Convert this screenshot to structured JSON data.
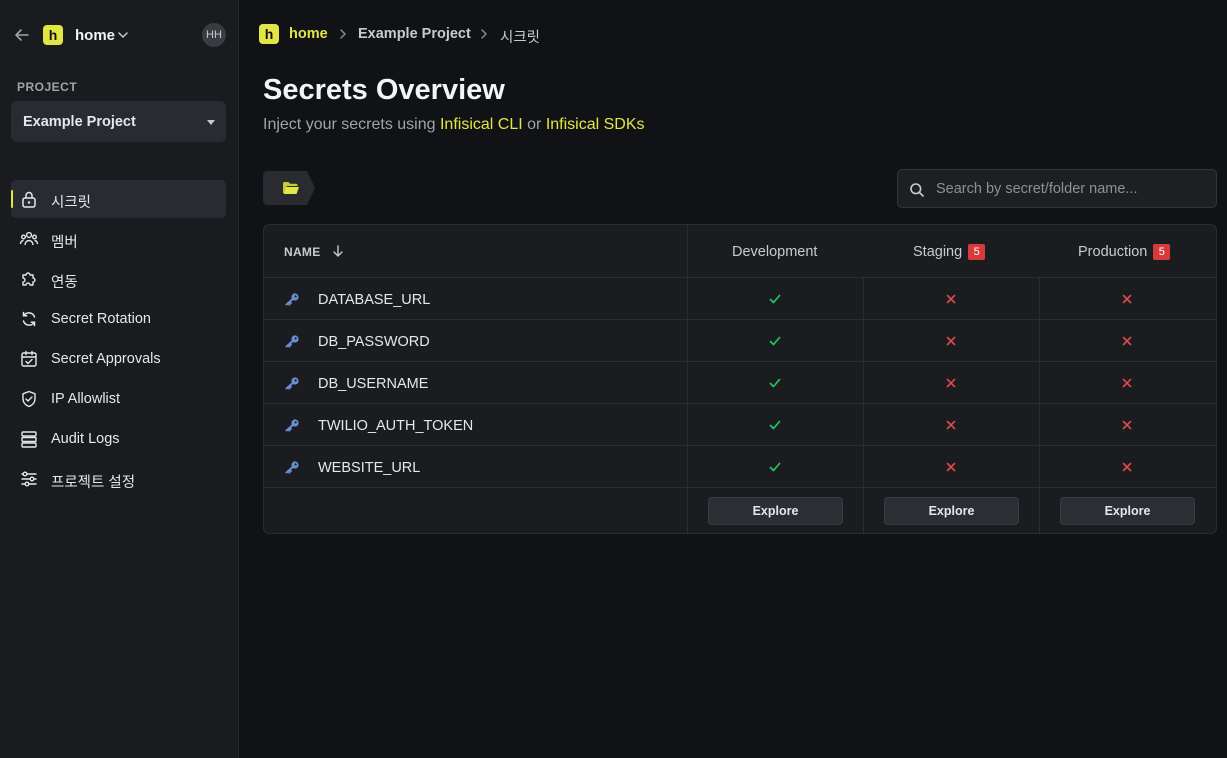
{
  "org": {
    "logo_letter": "h",
    "name": "home",
    "avatar_initials": "HH"
  },
  "project": {
    "section_label": "PROJECT",
    "selected": "Example Project"
  },
  "nav": {
    "items": [
      {
        "label": "시크릿",
        "icon": "lock-icon",
        "active": true
      },
      {
        "label": "멤버",
        "icon": "users-icon"
      },
      {
        "label": "연동",
        "icon": "puzzle-icon"
      },
      {
        "label": "Secret Rotation",
        "icon": "rotate-icon"
      },
      {
        "label": "Secret Approvals",
        "icon": "calendar-check-icon"
      },
      {
        "label": "IP Allowlist",
        "icon": "shield-check-icon"
      },
      {
        "label": "Audit Logs",
        "icon": "server-icon"
      },
      {
        "label": "프로젝트 설정",
        "icon": "sliders-icon"
      }
    ]
  },
  "breadcrumb": {
    "logo_letter": "h",
    "home": "home",
    "project": "Example Project",
    "current": "시크릿"
  },
  "page": {
    "title": "Secrets Overview",
    "subtitle_prefix": "Inject your secrets using",
    "subtitle_link1": "Infisical CLI",
    "subtitle_mid": "or",
    "subtitle_link2": "Infisical SDKs"
  },
  "search": {
    "placeholder": "Search by secret/folder name..."
  },
  "table": {
    "name_header": "NAME",
    "environments": [
      {
        "label": "Development",
        "badge": ""
      },
      {
        "label": "Staging",
        "badge": "5"
      },
      {
        "label": "Production",
        "badge": "5"
      }
    ],
    "rows": [
      {
        "name": "DATABASE_URL",
        "status": [
          "present",
          "missing",
          "missing"
        ]
      },
      {
        "name": "DB_PASSWORD",
        "status": [
          "present",
          "missing",
          "missing"
        ]
      },
      {
        "name": "DB_USERNAME",
        "status": [
          "present",
          "missing",
          "missing"
        ]
      },
      {
        "name": "TWILIO_AUTH_TOKEN",
        "status": [
          "present",
          "missing",
          "missing"
        ]
      },
      {
        "name": "WEBSITE_URL",
        "status": [
          "present",
          "missing",
          "missing"
        ]
      }
    ],
    "explore_label": "Explore"
  },
  "colors": {
    "accent": "#e2e645",
    "present": "#22c55e",
    "missing": "#e14848",
    "key_icon": "#6b8fd6"
  }
}
